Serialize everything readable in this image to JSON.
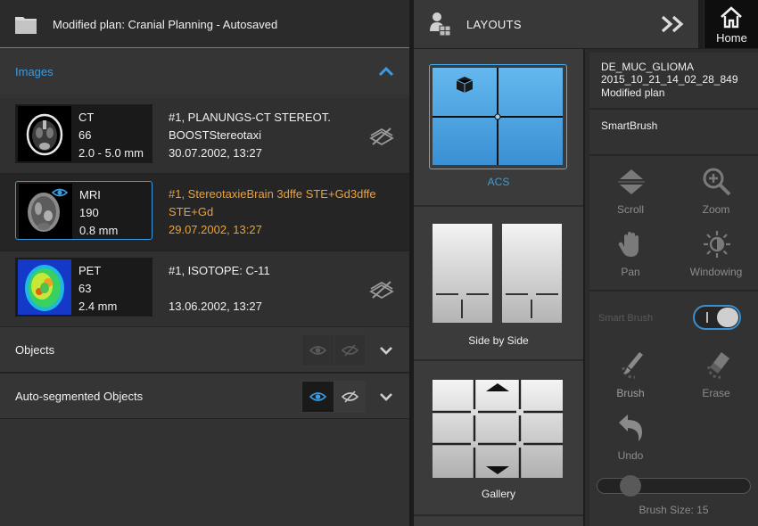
{
  "plan": {
    "title": "Modified plan: Cranial Planning - Autosaved"
  },
  "images": {
    "title": "Images",
    "rows": [
      {
        "modality": "CT",
        "count": "66",
        "thickness": "2.0 - 5.0 mm",
        "desc1": "#1, PLANUNGS-CT STEREOT.",
        "desc2": "BOOSTStereotaxi",
        "date": "30.07.2002, 13:27"
      },
      {
        "modality": "MRI",
        "count": "190",
        "thickness": "0.8 mm",
        "desc1": "#1, StereotaxieBrain 3dffe STE+Gd3dffe",
        "desc2": "STE+Gd",
        "date": "29.07.2002, 13:27"
      },
      {
        "modality": "PET",
        "count": "63",
        "thickness": "2.4 mm",
        "desc1": "#1, ISOTOPE: C-11",
        "desc2": "",
        "date": "13.06.2002, 13:27"
      }
    ]
  },
  "sections": {
    "objects": "Objects",
    "auto": "Auto-segmented Objects"
  },
  "layouts": {
    "title": "LAYOUTS",
    "items": [
      "ACS",
      "Side by Side",
      "Gallery"
    ]
  },
  "home": {
    "label": "Home"
  },
  "case": {
    "name": "DE_MUC_GLIOMA",
    "date": "2015_10_21_14_02_28_849",
    "plan": "Modified plan"
  },
  "tool": {
    "name": "SmartBrush",
    "view_tools": [
      "Scroll",
      "Zoom",
      "Pan",
      "Windowing"
    ],
    "smart_brush_label": "Smart Brush",
    "brush_tools": [
      "Brush",
      "Erase",
      "Undo"
    ],
    "brush_size_label": "Brush Size: 15",
    "brush_size_value": 15
  },
  "colors": {
    "accent": "#3b9be0",
    "selected_text": "#f0a030"
  }
}
